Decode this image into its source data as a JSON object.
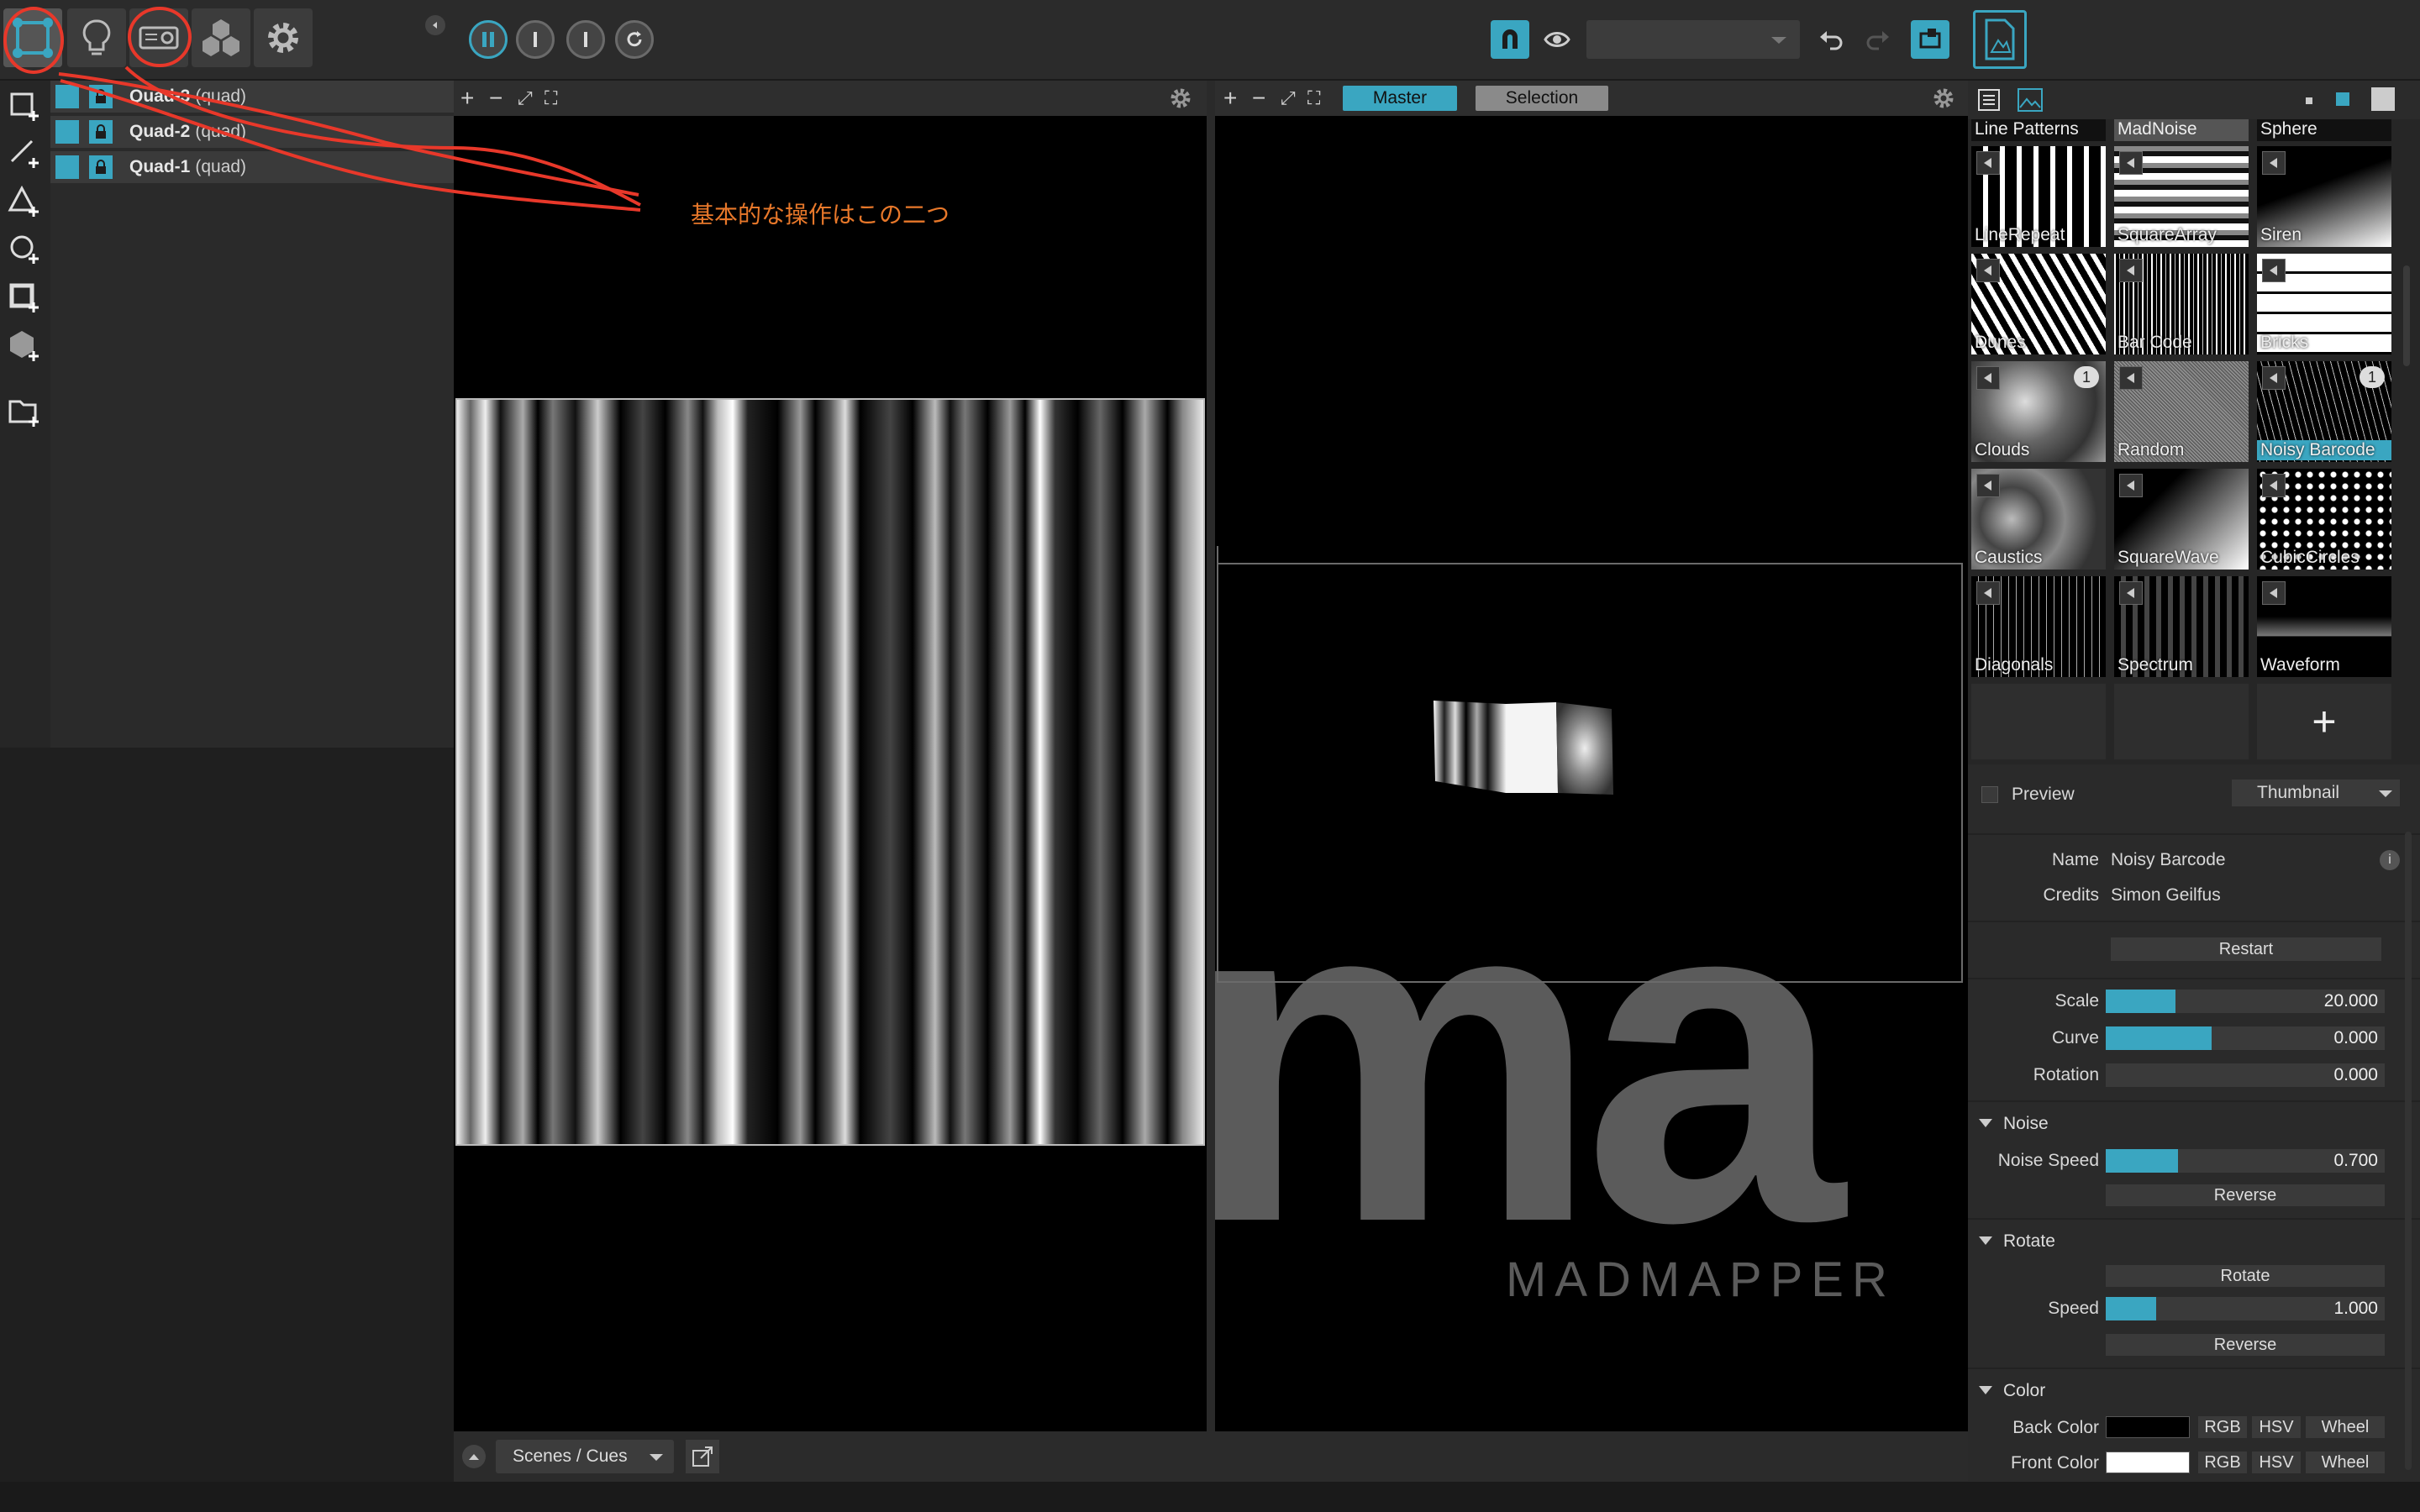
{
  "toolbar": {
    "mode_icons": [
      "surfaces-icon",
      "lightbulb-icon",
      "projector-icon",
      "cubes-icon",
      "gear-icon"
    ],
    "transport": [
      "pause-icon",
      "step-icon",
      "step-icon",
      "loop-icon"
    ],
    "right_icons": [
      "magnet-icon",
      "eye-icon",
      "undo-icon",
      "redo-icon",
      "output-icon",
      "document-icon"
    ]
  },
  "layers": [
    {
      "name": "Quad-3",
      "type": "(quad)"
    },
    {
      "name": "Quad-2",
      "type": "(quad)"
    },
    {
      "name": "Quad-1",
      "type": "(quad)"
    }
  ],
  "annotation": {
    "text": "基本的な操作はこの二つ",
    "color": "#e8782a"
  },
  "output_tabs": {
    "master": "Master",
    "selection": "Selection"
  },
  "viewport": {
    "symbols": [
      "+",
      "−",
      "⤢",
      "⛶"
    ]
  },
  "watermark": {
    "big": "ma",
    "brand": "MADMAPPER"
  },
  "bottom": {
    "scenes_label": "Scenes / Cues"
  },
  "library": {
    "header": [
      "Line Patterns",
      "MadNoise",
      "Sphere"
    ],
    "items": [
      {
        "name": "LineRepeat"
      },
      {
        "name": "SquareArray"
      },
      {
        "name": "Siren"
      },
      {
        "name": "Dunes"
      },
      {
        "name": "Bar Code"
      },
      {
        "name": "Bricks"
      },
      {
        "name": "Clouds",
        "badge": "1"
      },
      {
        "name": "Random"
      },
      {
        "name": "Noisy Barcode",
        "badge": "1",
        "selected": true
      },
      {
        "name": "Caustics"
      },
      {
        "name": "SquareWave"
      },
      {
        "name": "CubicCircles"
      },
      {
        "name": "Diagonals"
      },
      {
        "name": "Spectrum"
      },
      {
        "name": "Waveform"
      }
    ],
    "add_symbol": "+"
  },
  "properties": {
    "preview_label": "Preview",
    "preview_mode": "Thumbnail",
    "name_label": "Name",
    "name_value": "Noisy Barcode",
    "credits_label": "Credits",
    "credits_value": "Simon Geilfus",
    "restart": "Restart",
    "scale_label": "Scale",
    "scale_value": "20.000",
    "scale_fill": 0.25,
    "curve_label": "Curve",
    "curve_value": "0.000",
    "curve_fill": 0.38,
    "rotation_label": "Rotation",
    "rotation_value": "0.000",
    "rotation_fill": 0,
    "noise_section": "Noise",
    "noise_speed_label": "Noise Speed",
    "noise_speed_value": "0.700",
    "noise_speed_fill": 0.26,
    "noise_reverse": "Reverse",
    "rotate_section": "Rotate",
    "rotate_button": "Rotate",
    "speed_label": "Speed",
    "speed_value": "1.000",
    "speed_fill": 0.18,
    "rotate_reverse": "Reverse",
    "color_section": "Color",
    "back_color_label": "Back Color",
    "back_color": "#000000",
    "front_color_label": "Front Color",
    "front_color": "#ffffff",
    "rgb": "RGB",
    "hsv": "HSV",
    "wheel": "Wheel",
    "info": "i"
  },
  "colors": {
    "accent": "#3aa6c1",
    "annotation": "#e8382a"
  }
}
